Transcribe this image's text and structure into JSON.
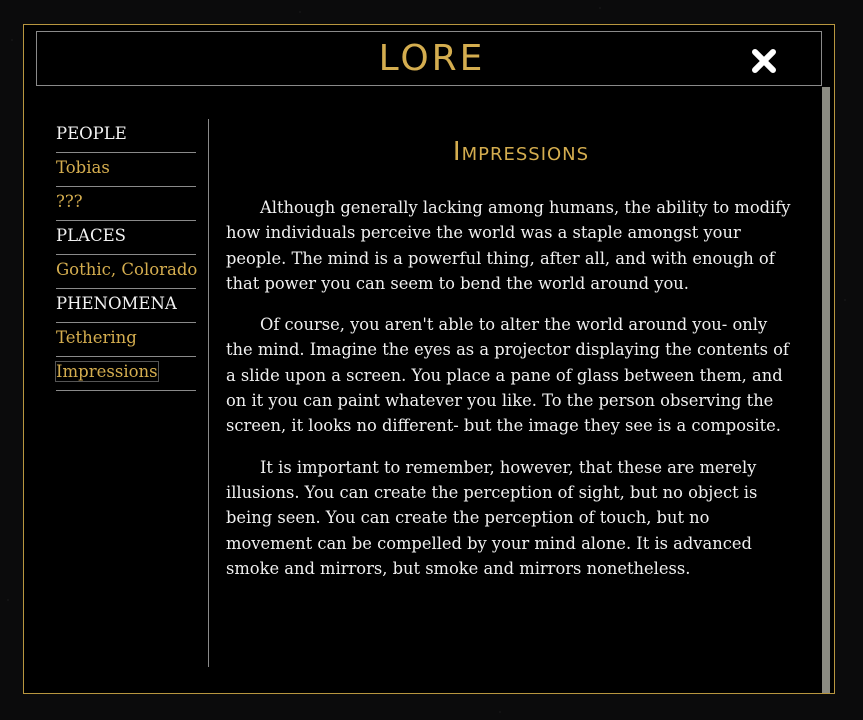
{
  "window": {
    "title": "LORE",
    "close_icon": "close-icon"
  },
  "colors": {
    "accent": "#d4ad4f",
    "text": "#f0f0f0",
    "border": "#b8963f"
  },
  "sidebar": {
    "items": [
      {
        "label": "PEOPLE",
        "type": "category"
      },
      {
        "label": "Tobias",
        "type": "entry"
      },
      {
        "label": "???",
        "type": "entry"
      },
      {
        "label": "PLACES",
        "type": "category"
      },
      {
        "label": "Gothic, Colorado",
        "type": "entry"
      },
      {
        "label": "PHENOMENA",
        "type": "category"
      },
      {
        "label": "Tethering",
        "type": "entry"
      },
      {
        "label": "Impressions",
        "type": "entry",
        "active": true
      }
    ]
  },
  "article": {
    "title": "Impressions",
    "paragraphs": [
      "Although generally lacking among humans, the ability to modify how individuals perceive the world was a staple amongst your people. The mind is a powerful thing, after all, and with enough of that power you can seem to bend the world around you.",
      "Of course, you aren't able to alter the world around you- only the mind. Imagine the eyes as a projector displaying the contents of a slide upon a screen. You place a pane of glass between them, and on it you can paint whatever you like. To the person observing the screen, it looks no different- but the image they see is a composite.",
      "It is important to remember, however, that these are merely illusions. You can create the perception of sight, but no object is being seen. You can create the perception of touch, but no movement can be compelled by your mind alone. It is advanced smoke and mirrors, but smoke and mirrors nonetheless."
    ]
  }
}
